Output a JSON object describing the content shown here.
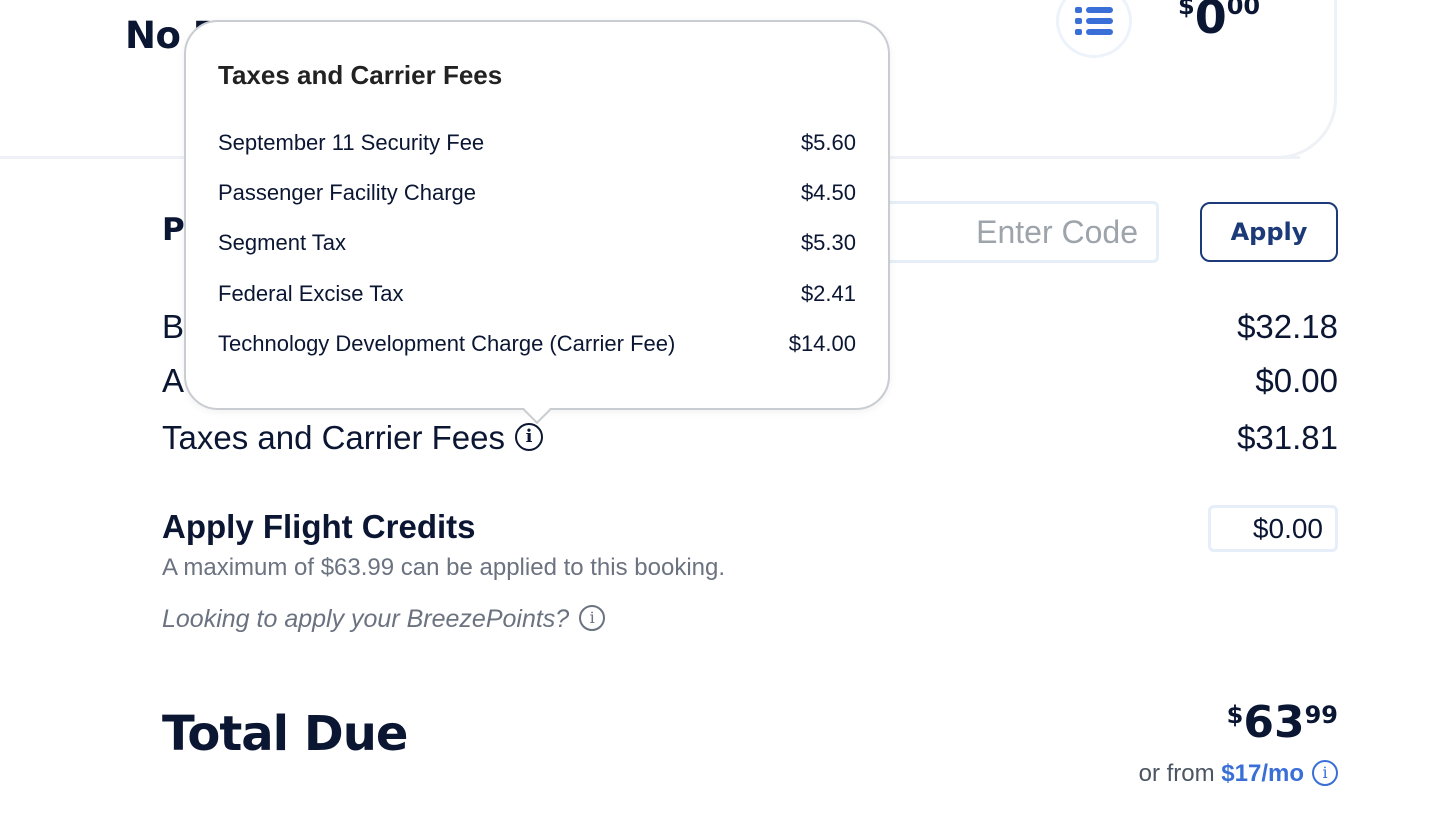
{
  "top_card": {
    "title": "No B",
    "price": {
      "currency": "$",
      "whole": "0",
      "cents": "00"
    },
    "icon": "list-icon"
  },
  "promo": {
    "label": "P",
    "placeholder": "Enter Code",
    "apply_label": "Apply"
  },
  "fare_rows": [
    {
      "label": "B",
      "amount": "$32.18"
    },
    {
      "label": "A",
      "amount": "$0.00"
    },
    {
      "label": "Taxes and Carrier Fees",
      "amount": "$31.81"
    }
  ],
  "flight_credits": {
    "title": "Apply Flight Credits",
    "note": "A maximum of $63.99 can be applied to this booking.",
    "value": "$0.00"
  },
  "breeze_points": {
    "text": "Looking to apply your BreezePoints?"
  },
  "total": {
    "label": "Total Due",
    "currency": "$",
    "whole": "63",
    "cents": "99",
    "monthly_prefix": "or from",
    "monthly_link": "$17/mo"
  },
  "tooltip": {
    "title": "Taxes and Carrier Fees",
    "items": [
      {
        "label": "September 11 Security Fee",
        "amount": "$5.60"
      },
      {
        "label": "Passenger Facility Charge",
        "amount": "$4.50"
      },
      {
        "label": "Segment Tax",
        "amount": "$5.30"
      },
      {
        "label": "Federal Excise Tax",
        "amount": "$2.41"
      },
      {
        "label": "Technology Development Charge (Carrier Fee)",
        "amount": "$14.00"
      }
    ]
  },
  "colors": {
    "navy": "#0b1633",
    "link_blue": "#3a6fd8",
    "button_border": "#1c3a78",
    "muted_text": "#6b7280"
  }
}
